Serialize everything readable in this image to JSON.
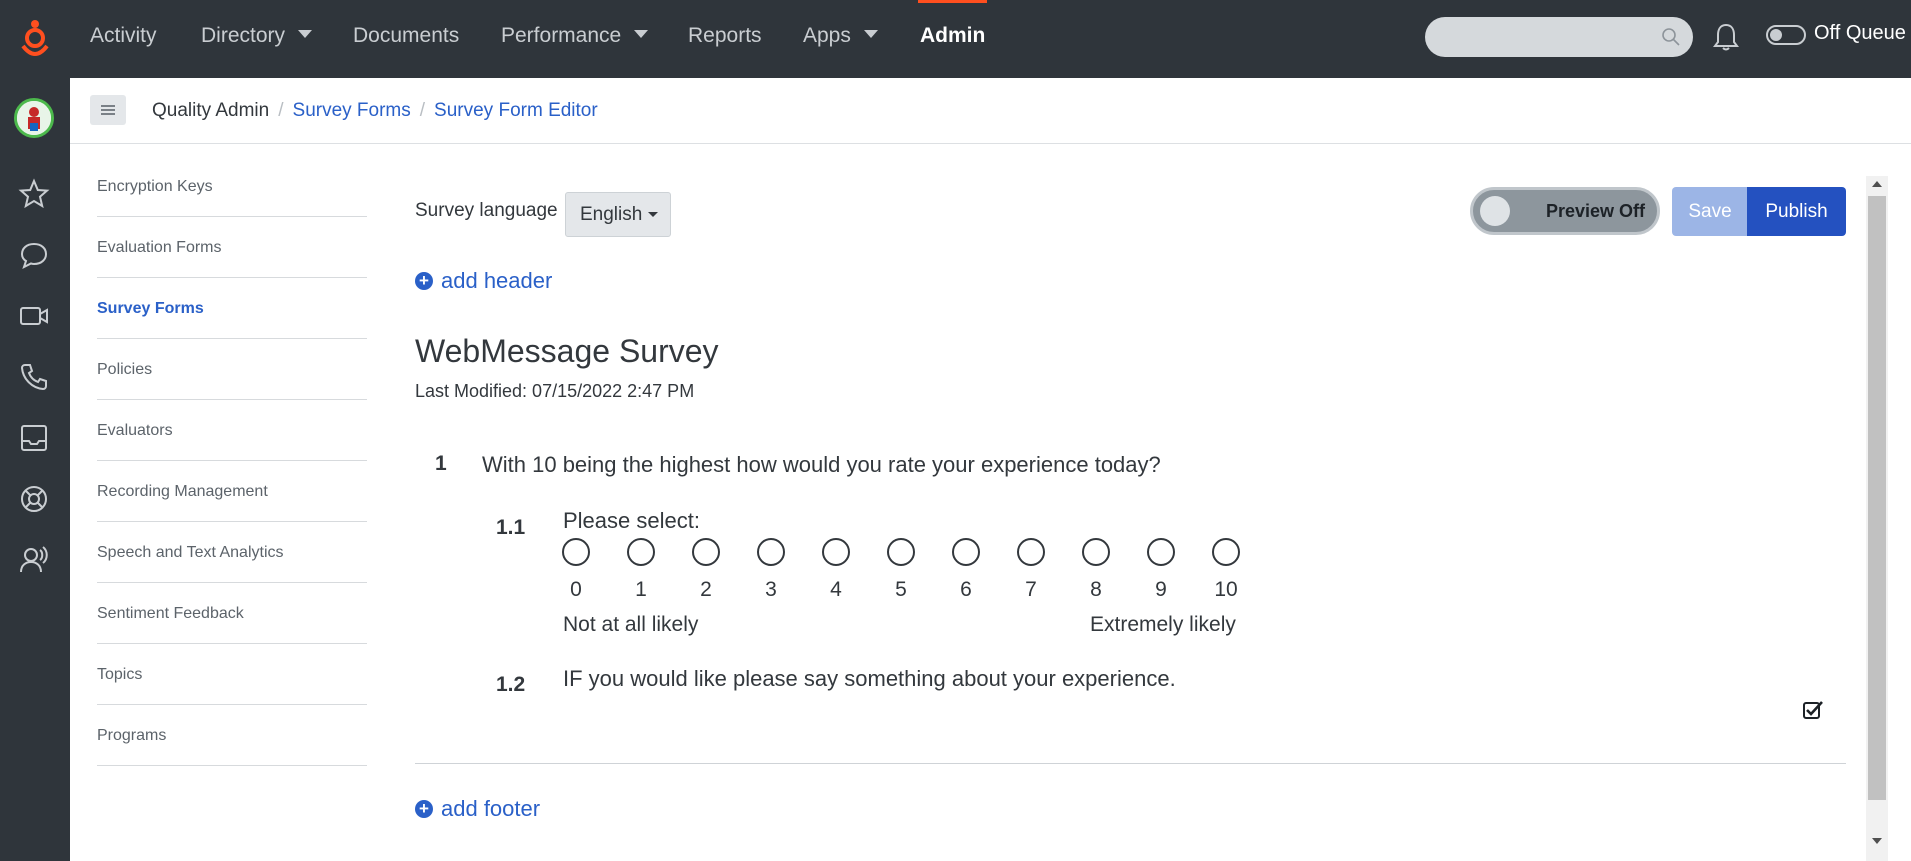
{
  "nav": {
    "items": [
      {
        "label": "Activity",
        "dropdown": false
      },
      {
        "label": "Directory",
        "dropdown": true
      },
      {
        "label": "Documents",
        "dropdown": false
      },
      {
        "label": "Performance",
        "dropdown": true
      },
      {
        "label": "Reports",
        "dropdown": false
      },
      {
        "label": "Apps",
        "dropdown": true
      },
      {
        "label": "Admin",
        "dropdown": false,
        "active": true
      }
    ],
    "search_placeholder": "",
    "queue_status": "Off Queue"
  },
  "rail": {
    "icons": [
      "favorites-icon",
      "chat-icon",
      "video-icon",
      "phone-icon",
      "inbox-icon",
      "help-icon",
      "people-icon"
    ]
  },
  "breadcrumb": {
    "root": "Quality Admin",
    "level1": "Survey Forms",
    "level2": "Survey Form Editor"
  },
  "sidemenu": {
    "items": [
      {
        "label": "Encryption Keys"
      },
      {
        "label": "Evaluation Forms"
      },
      {
        "label": "Survey Forms",
        "active": true
      },
      {
        "label": "Policies"
      },
      {
        "label": "Evaluators"
      },
      {
        "label": "Recording Management"
      },
      {
        "label": "Speech and Text Analytics"
      },
      {
        "label": "Sentiment Feedback"
      },
      {
        "label": "Topics"
      },
      {
        "label": "Programs"
      }
    ]
  },
  "editor": {
    "language_label": "Survey language",
    "language_value": "English",
    "preview_label": "Preview Off",
    "save_label": "Save",
    "publish_label": "Publish",
    "add_header_label": "add header",
    "add_footer_label": "add footer",
    "form_title": "WebMessage Survey",
    "last_modified": "Last Modified: 07/15/2022 2:47 PM",
    "question_group": {
      "number": "1",
      "text": "With 10 being the highest how would you rate your experience today?"
    },
    "question_1_1": {
      "number": "1.1",
      "text": "Please select:",
      "options": [
        "0",
        "1",
        "2",
        "3",
        "4",
        "5",
        "6",
        "7",
        "8",
        "9",
        "10"
      ],
      "low_label": "Not at all likely",
      "high_label": "Extremely likely"
    },
    "question_1_2": {
      "number": "1.2",
      "text": "IF you would like please say something about your experience."
    }
  },
  "colors": {
    "nav_bg": "#2f353b",
    "accent": "#ff4f1f",
    "link": "#2a60c8",
    "publish": "#2451c0",
    "save_disabled": "#9cb5e6"
  }
}
